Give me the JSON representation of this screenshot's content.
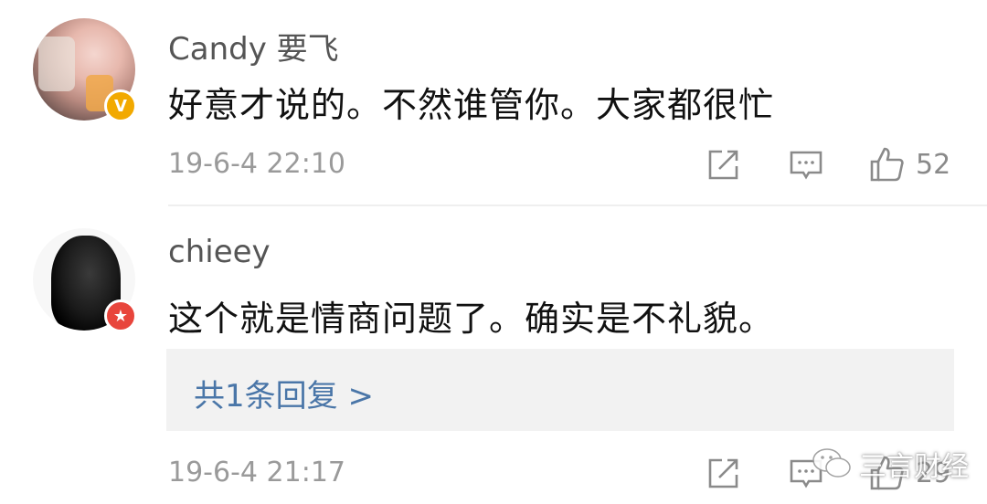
{
  "comments": [
    {
      "username": "Candy 要飞",
      "text": "好意才说的。不然谁管你。大家都很忙",
      "timestamp": "19-6-4 22:10",
      "likes": "52",
      "badge": "V",
      "badge_color": "#f2a900"
    },
    {
      "username": "chieey",
      "text": "这个就是情商问题了。确实是不礼貌。",
      "timestamp": "19-6-4 21:17",
      "likes": "29",
      "badge": "★",
      "badge_color": "#e8453c",
      "reply_link": "共1条回复 >"
    }
  ],
  "watermark": {
    "text": "三言财经",
    "icon": "wechat-icon"
  },
  "icons": {
    "share": "share-icon",
    "comment": "comment-icon",
    "like": "thumbs-up-icon"
  }
}
